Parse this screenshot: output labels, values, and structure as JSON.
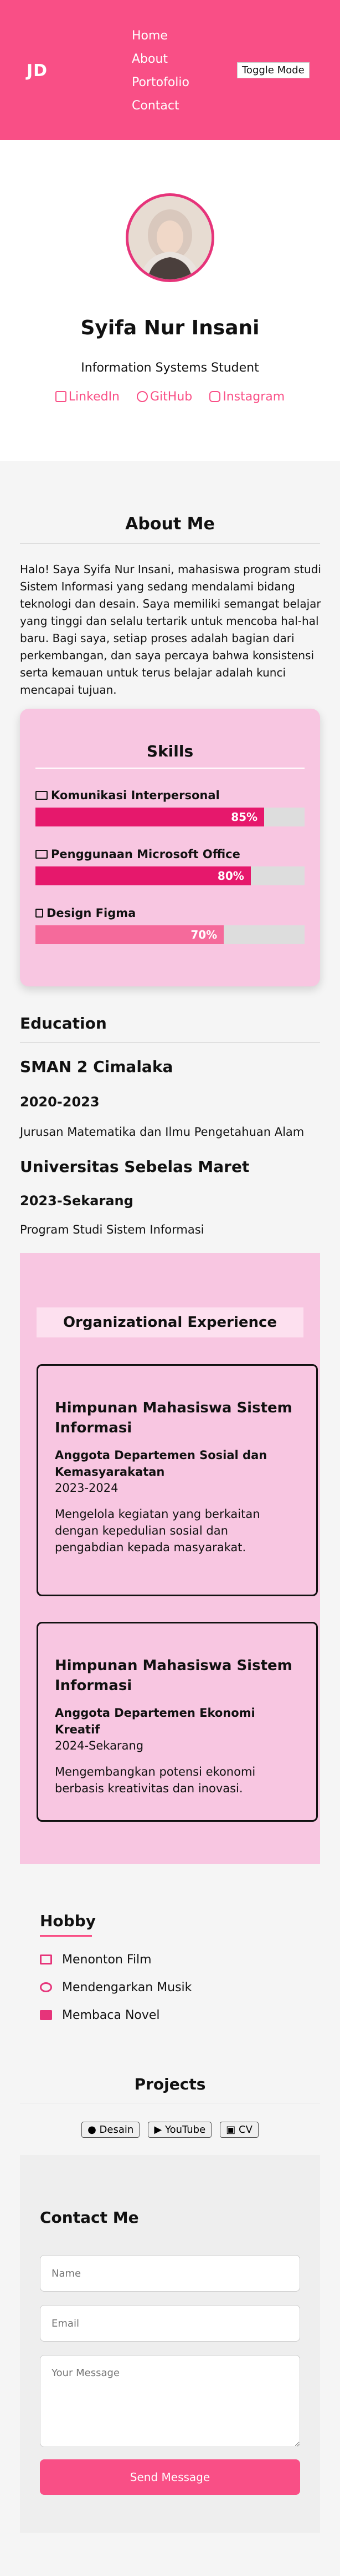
{
  "header": {
    "logo": "JD",
    "nav": [
      "Home",
      "About",
      "Portofolio",
      "Contact"
    ],
    "toggle_label": "Toggle Mode"
  },
  "profile": {
    "name": "Syifa Nur Insani",
    "subtitle": "Information Systems Student",
    "socials": [
      "LinkedIn",
      "GitHub",
      "Instagram"
    ]
  },
  "about": {
    "title": "About Me",
    "text": "Halo! Saya Syifa Nur Insani, mahasiswa program studi Sistem Informasi yang sedang mendalami bidang teknologi dan desain. Saya memiliki semangat belajar yang tinggi dan selalu tertarik untuk mencoba hal-hal baru. Bagi saya, setiap proses adalah bagian dari perkembangan, dan saya percaya bahwa konsistensi serta kemauan untuk terus belajar adalah kunci mencapai tujuan."
  },
  "skills": {
    "title": "Skills",
    "items": [
      {
        "label": "Komunikasi Interpersonal",
        "percent_text": "85%",
        "level": 85
      },
      {
        "label": "Penggunaan Microsoft Office",
        "percent_text": "80%",
        "level": 80
      },
      {
        "label": "Design Figma",
        "percent_text": "70%",
        "level": 70
      }
    ]
  },
  "education": {
    "title": "Education",
    "items": [
      {
        "school": "SMAN 2 Cimalaka",
        "years": "2020-2023",
        "desc": "Jurusan Matematika dan Ilmu Pengetahuan Alam"
      },
      {
        "school": "Universitas Sebelas Maret",
        "years": "2023-Sekarang",
        "desc": "Program Studi Sistem Informasi"
      }
    ]
  },
  "organization": {
    "title": "Organizational Experience",
    "items": [
      {
        "name": "Himpunan Mahasiswa Sistem Informasi",
        "role": "Anggota Departemen Sosial dan Kemasyarakatan",
        "period": "2023-2024",
        "desc": "Mengelola kegiatan yang berkaitan dengan kepedulian sosial dan pengabdian kepada masyarakat."
      },
      {
        "name": "Himpunan Mahasiswa Sistem Informasi",
        "role": "Anggota Departemen Ekonomi Kreatif",
        "period": "2024-Sekarang",
        "desc": "Mengembangkan potensi ekonomi berbasis kreativitas dan inovasi."
      }
    ]
  },
  "hobby": {
    "title": "Hobby",
    "items": [
      "Menonton Film",
      "Mendengarkan Musik",
      "Membaca Novel"
    ]
  },
  "projects": {
    "title": "Projects",
    "buttons": [
      "Desain",
      "YouTube",
      "CV"
    ]
  },
  "contact": {
    "title": "Contact Me",
    "name_placeholder": "Name",
    "email_placeholder": "Email",
    "message_placeholder": "Your Message",
    "send_label": "Send Message"
  },
  "colors": {
    "brand": "#f94f86",
    "bar": "#e6186c",
    "card": "#f8c6e1"
  }
}
